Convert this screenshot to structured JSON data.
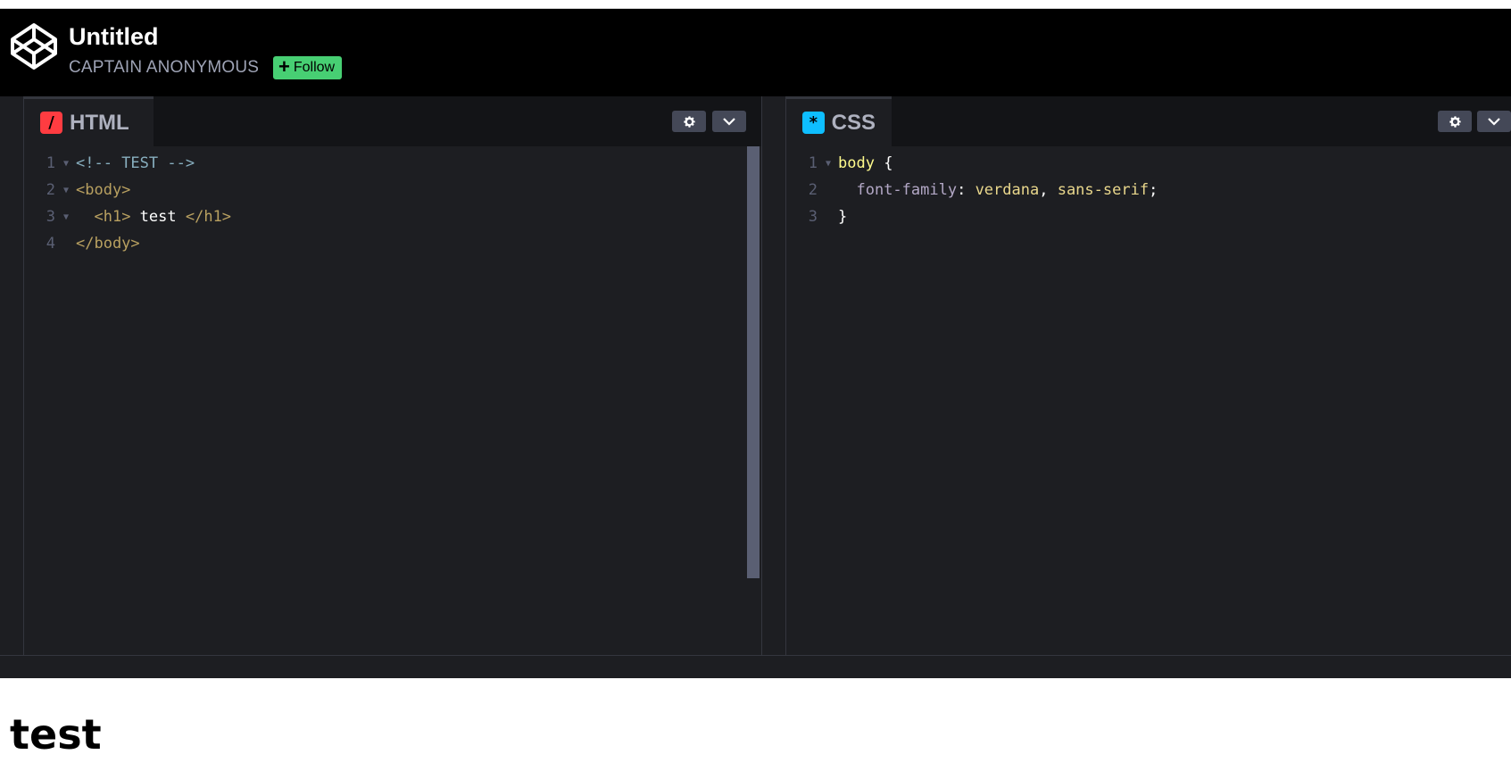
{
  "header": {
    "title": "Untitled",
    "author": "CAPTAIN ANONYMOUS",
    "follow_label": "Follow"
  },
  "panes": {
    "html": {
      "label": "HTML",
      "icon_glyph": "/"
    },
    "css": {
      "label": "CSS",
      "icon_glyph": "*"
    }
  },
  "html_code": {
    "line_numbers": [
      "1",
      "2",
      "3",
      "4"
    ],
    "lines": [
      {
        "parts": [
          "<!-- TEST -->"
        ]
      },
      {
        "parts": [
          "<body>"
        ]
      },
      {
        "parts": [
          "  ",
          "<h1>",
          " test ",
          "</h1>"
        ]
      },
      {
        "parts": [
          "</body>"
        ]
      }
    ]
  },
  "css_code": {
    "line_numbers": [
      "1",
      "2",
      "3"
    ],
    "lines": [
      {
        "parts": [
          "body",
          " {"
        ]
      },
      {
        "parts": [
          "  ",
          "font-family",
          ": ",
          "verdana",
          ", ",
          "sans-serif",
          ";"
        ]
      },
      {
        "parts": [
          "}"
        ]
      }
    ]
  },
  "preview": {
    "heading": "test"
  },
  "colors": {
    "follow_green": "#47cf73",
    "html_icon": "#ff3c41",
    "css_icon": "#0ebeff",
    "editor_bg": "#1d1e22",
    "header_bg": "#000000"
  },
  "icons": {
    "logo": "codepen-logo-icon",
    "settings": "gear-icon",
    "collapse": "chevron-down-icon",
    "follow": "plus-icon"
  }
}
